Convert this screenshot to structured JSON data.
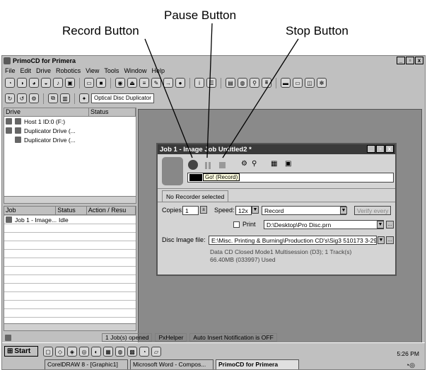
{
  "callouts": {
    "record": "Record Button",
    "pause": "Pause Button",
    "stop": "Stop Button"
  },
  "app": {
    "title": "PrimoCD for Primera",
    "menu": [
      "File",
      "Edit",
      "Drive",
      "Robotics",
      "View",
      "Tools",
      "Window",
      "Help"
    ],
    "toolbar2_combo": "Optical Disc Duplicator"
  },
  "drives": {
    "headers": [
      "Drive",
      "Status"
    ],
    "items": [
      "Host 1 ID:0 (F:)",
      "Duplicator Drive (...",
      "Duplicator Drive (..."
    ]
  },
  "jobs": {
    "headers": [
      "Job",
      "Status",
      "Action / Resu"
    ],
    "rows": [
      {
        "job": "Job 1 - Image...",
        "status": "Idle"
      }
    ]
  },
  "status": {
    "jobs": "1 Job(s) opened",
    "helper": "PxHelper",
    "auto": "Auto Insert Notification is OFF"
  },
  "dialog": {
    "title": "Job 1 - Image Job Untitled2 *",
    "tooltip": "Go! (Record)",
    "recorder_tab": "No Recorder selected",
    "copies_label": "Copies:",
    "copies": "1",
    "speed_label": "Speed:",
    "speed": "12x",
    "mode": "Record",
    "verify": "Verify every",
    "print_label": "Print",
    "print_file": "D:\\Desktop\\Pro Disc.prn",
    "image_label": "Disc Image file:",
    "image_file": "E:\\Misc. Printing & Burning\\Production CD's\\Sig3 510173 3-29-",
    "info1": "Data CD Closed Mode1 Multisession (D3); 1 Track(s)",
    "info2": "66.40MB (033997) Used"
  },
  "taskbar": {
    "start": "Start",
    "tasks": [
      "CorelDRAW 8 - [Graphic1]",
      "Microsoft Word - Compos...",
      "PrimoCD for Primera"
    ],
    "clock": "5:26 PM"
  }
}
